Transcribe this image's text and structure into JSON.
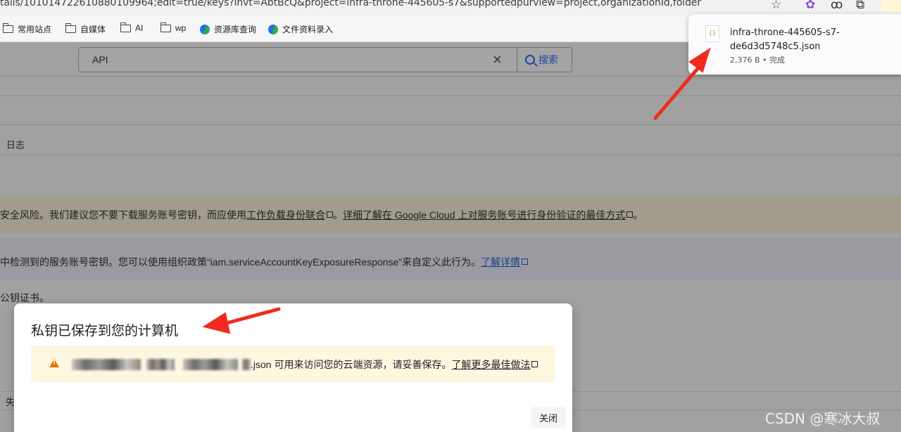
{
  "browser": {
    "url": "tails/101014722610880109964;edit=true/keys?invt=AbtBcQ&project=infra-throne-445605-s7&supportedpurview=project,organizationId,folder",
    "star_icon": "☆",
    "bookmarks": [
      {
        "label": "常用站点",
        "icon": "folder-icon"
      },
      {
        "label": "自媒体",
        "icon": "folder-icon"
      },
      {
        "label": "AI",
        "icon": "folder-icon"
      },
      {
        "label": "wp",
        "icon": "folder-icon"
      },
      {
        "label": "资源库查询",
        "icon": "site-icon"
      },
      {
        "label": "文件资料录入",
        "icon": "site-icon"
      }
    ]
  },
  "search": {
    "value": "API",
    "clear_icon": "×",
    "button_label": "搜索"
  },
  "page": {
    "log_label": "日志",
    "warning_prefix": "安全风险。我们建议您不要下载服务账号密钥，而应使用",
    "warning_link1": "工作负载身份联合",
    "warning_mid": "。",
    "warning_link2": "详细了解在 Google Cloud 上对服务账号进行身份验证的最佳方式",
    "warning_suffix": "。",
    "info_prefix": "中检测到的服务账号密钥。您可以使用组织政策“iam.serviceAccountKeyExposureResponse”来自定义此行为。",
    "info_link": "了解详情",
    "cert_text": "公钥证书。",
    "lost_label": "失"
  },
  "download": {
    "file_name": "infra-throne-445605-s7-de6d3d5748c5.json",
    "meta": "2,376 B • 完成",
    "file_icon": "{}"
  },
  "dialog": {
    "title": "私钥已保存到您的计算机",
    "alert_suffix": ".json 可用来访问您的云端资源，请妥善保存。",
    "alert_link": "了解更多最佳做法",
    "close_label": "关闭"
  },
  "colors": {
    "annotation_arrow": "#ef2b1f",
    "link": "#1a46a0",
    "alert_bg": "#fef7e0",
    "warning_icon": "#e37400"
  },
  "watermark": "CSDN @寒冰大叔"
}
